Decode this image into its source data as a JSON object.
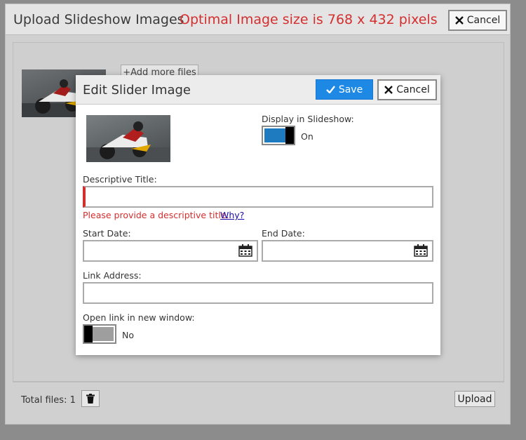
{
  "outer": {
    "title": "Upload Slideshow Images",
    "hint": "Optimal Image size is 768 x 432 pixels",
    "cancel_label": "Cancel",
    "add_files_label": "+Add more files",
    "total_files_label": "Total files: 1",
    "upload_label": "Upload"
  },
  "dialog": {
    "title": "Edit Slider Image",
    "save_label": "Save",
    "cancel_label": "Cancel",
    "display_label": "Display in Slideshow:",
    "display_state": "On",
    "descriptive_title_label": "Descriptive Title:",
    "descriptive_title_value": "",
    "error_message": "Please provide a descriptive title.",
    "why_link": "Why?",
    "start_date_label": "Start Date:",
    "start_date_value": "",
    "end_date_label": "End Date:",
    "end_date_value": "",
    "link_address_label": "Link Address:",
    "link_address_value": "",
    "open_new_window_label": "Open link in new window:",
    "open_new_window_state": "No"
  },
  "colors": {
    "accent": "#1e88e5",
    "error": "#d32f2f",
    "toggle_on": "#1e7bc0"
  },
  "icons": {
    "cancel": "close-icon",
    "save": "checkmark-icon",
    "calendar": "calendar-icon",
    "trash": "trash-icon"
  }
}
